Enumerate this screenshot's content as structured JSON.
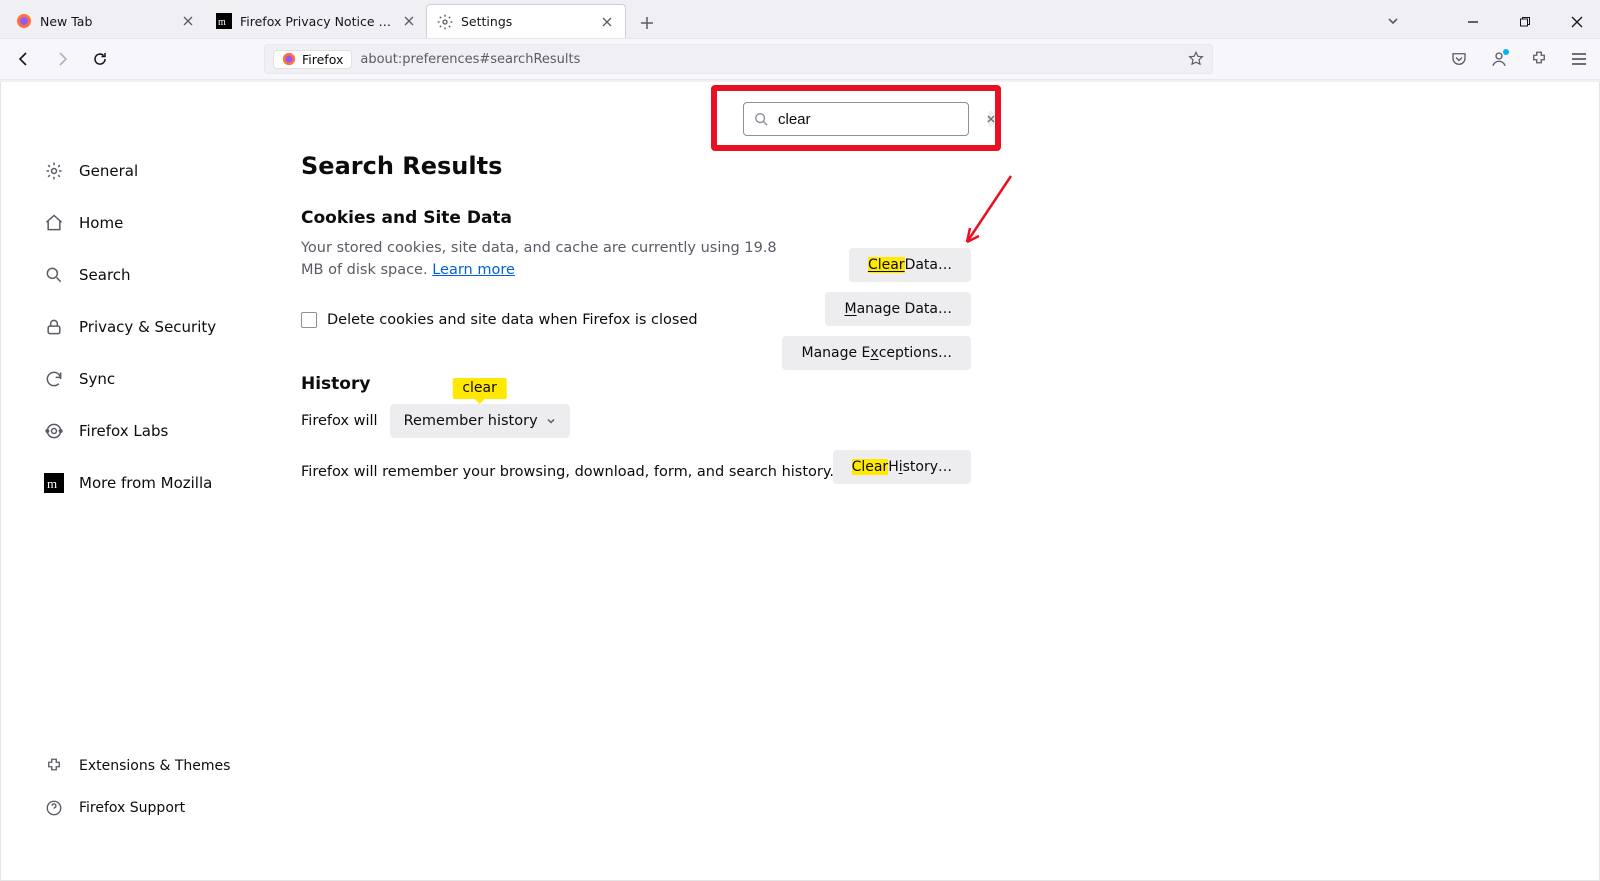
{
  "tabs": [
    {
      "title": "New Tab",
      "favicon": "firefox"
    },
    {
      "title": "Firefox Privacy Notice — Mozil",
      "favicon": "mozilla"
    },
    {
      "title": "Settings",
      "favicon": "gear",
      "active": true
    }
  ],
  "address_bar": {
    "chip": "Firefox",
    "url": "about:preferences#searchResults"
  },
  "search": {
    "value": "clear"
  },
  "sidebar": {
    "items": [
      {
        "label": "General",
        "icon": "gear"
      },
      {
        "label": "Home",
        "icon": "home"
      },
      {
        "label": "Search",
        "icon": "search"
      },
      {
        "label": "Privacy & Security",
        "icon": "lock"
      },
      {
        "label": "Sync",
        "icon": "sync"
      },
      {
        "label": "Firefox Labs",
        "icon": "labs"
      },
      {
        "label": "More from Mozilla",
        "icon": "mozilla"
      }
    ],
    "bottom": [
      {
        "label": "Extensions & Themes",
        "icon": "puzzle"
      },
      {
        "label": "Firefox Support",
        "icon": "help"
      }
    ]
  },
  "main": {
    "title": "Search Results",
    "cookies": {
      "heading": "Cookies and Site Data",
      "desc_prefix": "Your stored cookies, site data, and cache are currently using 19.8 MB of disk space. ",
      "learn_more": "Learn more",
      "checkbox_label_pre": "Delete ",
      "checkbox_label_u": "c",
      "checkbox_label_post": "ookies and site data when Firefox is closed",
      "btn_clear_pre": "Clear",
      "btn_clear_post": " Data…",
      "btn_manage_u": "M",
      "btn_manage_post": "anage Data…",
      "btn_exceptions_pre": "Manage E",
      "btn_exceptions_u": "x",
      "btn_exceptions_post": "ceptions…"
    },
    "history": {
      "heading": "History",
      "clear_tag": "clear",
      "will_pre": "Firefox ",
      "will_u": "w",
      "will_post": "ill",
      "select_label": "Remember history",
      "desc": "Firefox will remember your browsing, download, form, and search history.",
      "btn_clear_pre": "Clear",
      "btn_clear_mid": " H",
      "btn_clear_u": "i",
      "btn_clear_post": "story…"
    }
  }
}
